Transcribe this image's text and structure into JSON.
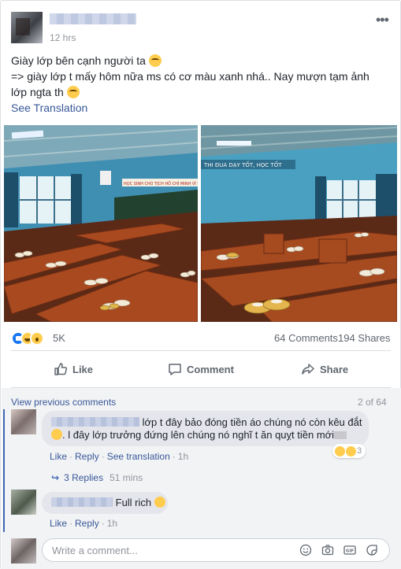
{
  "post": {
    "time": "12 hrs",
    "text_line1": "Giày lớp bên cạnh người ta",
    "text_line2": "=> giày lớp t mấy hôm nữa ms có cơ màu xanh nhá.. Nay mượn tạm ảnh",
    "text_line3": "lớp ngta th",
    "see_translation": "See Translation"
  },
  "photos": {
    "left_banner": "HỌC SINH CHÚ TỊCH HỒ CHÍ MINH VĨ ĐẠI",
    "right_banner": "THI ĐUA DẠY TỐT, HỌC TỐT"
  },
  "stats": {
    "reactions": "5K",
    "comments": "64 Comments",
    "shares": "194 Shares"
  },
  "actions": {
    "like": "Like",
    "comment": "Comment",
    "share": "Share"
  },
  "comments_header": {
    "view_previous": "View previous comments",
    "page_count": "2 of 64"
  },
  "comment1": {
    "line1": "lớp t đây bảo đóng tiền áo chúng nó còn kêu đắt",
    "line2": ". l đây lớp trưởng đứng lên chúng nó nghĩ t ăn quỵt tiền mới",
    "like": "Like",
    "reply": "Reply",
    "see_translation": "See translation",
    "time": "1h",
    "reaction_count": "3",
    "replies": "3 Replies",
    "replies_time": "51 mins"
  },
  "comment2": {
    "text": "Full rich",
    "like": "Like",
    "reply": "Reply",
    "time": "1h"
  },
  "composer": {
    "placeholder": "Write a comment..."
  },
  "icons": {
    "like_reaction": "like-icon",
    "haha_reaction": "haha-icon",
    "wow_reaction": "wow-icon",
    "more": "ellipsis-icon",
    "emoji": "smiley-icon",
    "camera": "camera-icon",
    "gif": "gif-icon",
    "sticker": "sticker-icon"
  },
  "colors": {
    "link": "#385898",
    "secondary_text": "#90949c",
    "like_blue": "#1877f2",
    "bubble": "#e4e6eb"
  }
}
